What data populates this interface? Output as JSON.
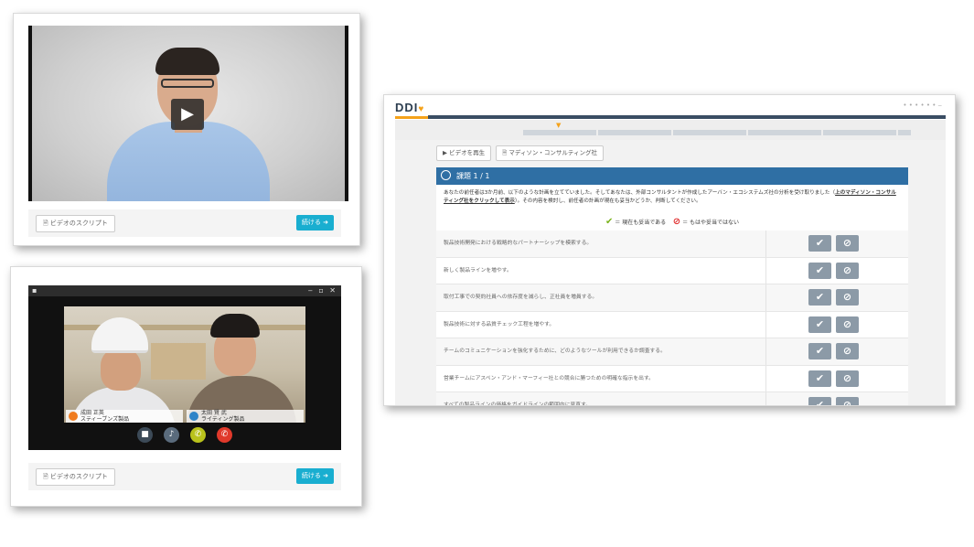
{
  "card1": {
    "script_label": "ビデオのスクリプト",
    "next_label": "続ける ➜",
    "play_glyph": "▶"
  },
  "card2": {
    "script_label": "ビデオのスクリプト",
    "next_label": "続ける ➜",
    "window_controls": "‒ ▫ ✕",
    "participants": [
      {
        "name": "成田 正英",
        "role": "スティーブンズ製品"
      },
      {
        "name": "太田 賢 武",
        "role": "ライティング製品"
      }
    ],
    "call_buttons": [
      "camera-icon",
      "mic-icon",
      "phone-icon",
      "hangup-icon"
    ]
  },
  "card3": {
    "logo": "DDI",
    "play_video_label": "ビデオを再生",
    "consulting_label": "マディソン・コンサルティング社",
    "task_title": "課題 1 / 1",
    "instructions_main": "あなたの前任者は3か月前、以下のような計画を立てていました。そしてあなたは、外部コンサルタントが作成したアーバン・エコシステムズ社の分析を受け取りました（",
    "instructions_link": "上のマディソン・コンサルティング社をクリックして表示",
    "instructions_tail": "）。その内容を検討し、前任者の計画が現在も妥当かどうか、判断してください。",
    "legend_ok": "＝ 現在も妥当である",
    "legend_ng": "＝ もはや妥当ではない",
    "rows": [
      "製品技術開発における戦略的なパートナーシップを模索する。",
      "新しく製品ラインを増やす。",
      "取付工事での契約社員への依存度を減らし、正社員を増員する。",
      "製品技術に対する品質チェック工程を増やす。",
      "チームのコミュニケーションを強化するために、どのようなツールが利用できるか調査する。",
      "営業チームにアスペン・アンド・マーフィー社との競合に勝つための明確な指示を出す。",
      "すべての製品ラインの価格をガイドラインの範囲内に見直す。"
    ],
    "approve_glyph": "✔",
    "reject_glyph": "⊘"
  }
}
